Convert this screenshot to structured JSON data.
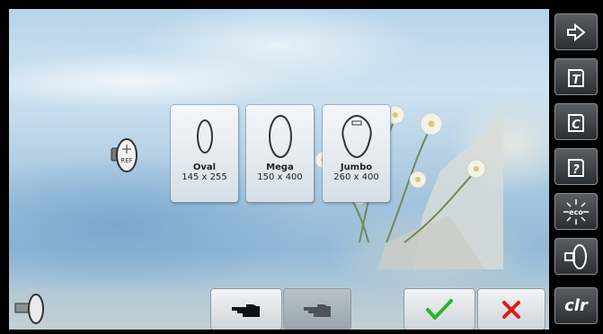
{
  "frames": [
    {
      "name": "Oval",
      "size": "145 x 255"
    },
    {
      "name": "Mega",
      "size": "150 x 400"
    },
    {
      "name": "Jumbo",
      "size": "260 x 400"
    }
  ],
  "reference_hoop_label": "REF",
  "sidebar": {
    "buttons": [
      {
        "icon": "exit-arrow-icon",
        "name": "exit-button"
      },
      {
        "icon": "tutorial-icon",
        "label": "T"
      },
      {
        "icon": "creative-consultant-icon",
        "label": "C"
      },
      {
        "icon": "help-icon",
        "label": "?"
      },
      {
        "icon": "eco-icon",
        "label": "eco"
      },
      {
        "icon": "hoop-select-icon"
      },
      {
        "icon": "clear-icon",
        "label": "clr"
      }
    ]
  },
  "colors": {
    "confirm": "#2db52d",
    "cancel": "#e01a1a"
  }
}
